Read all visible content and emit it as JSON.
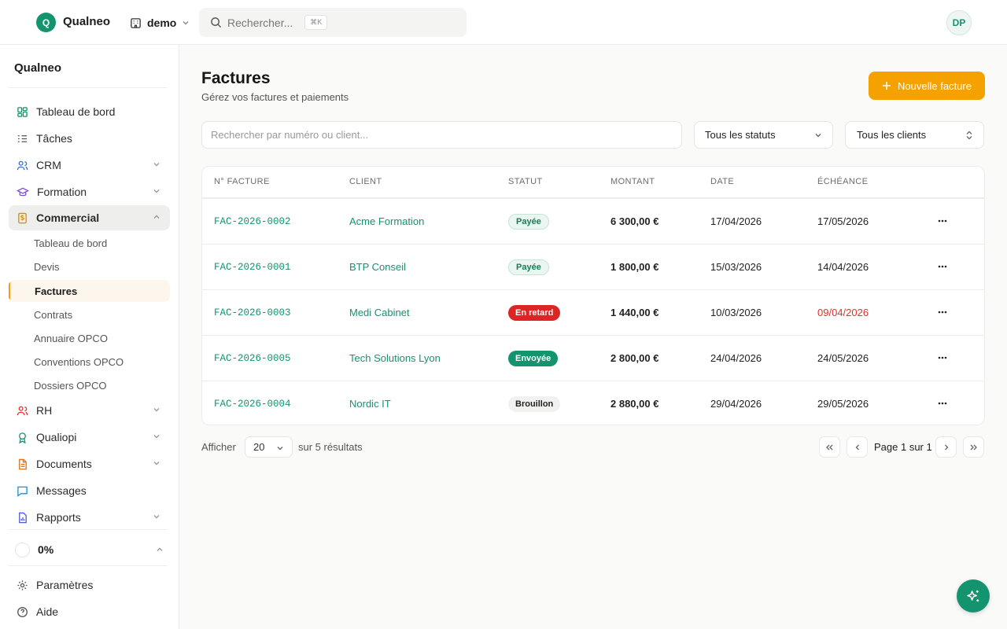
{
  "topbar": {
    "logo_letter": "Q",
    "app_name": "Qualneo",
    "workspace": "demo",
    "search_placeholder": "Rechercher...",
    "search_shortcut": "⌘K",
    "user_initials": "DP"
  },
  "sidebar": {
    "title": "Qualneo",
    "items": [
      {
        "label": "Tableau de bord",
        "icon": "dashboard-icon"
      },
      {
        "label": "Tâches",
        "icon": "tasks-icon"
      },
      {
        "label": "CRM",
        "icon": "users-icon"
      },
      {
        "label": "Formation",
        "icon": "graduation-cap-icon"
      },
      {
        "label": "Commercial",
        "icon": "dollar-file-icon"
      },
      {
        "label": "RH",
        "icon": "people-icon"
      },
      {
        "label": "Qualiopi",
        "icon": "award-icon"
      },
      {
        "label": "Documents",
        "icon": "document-icon"
      },
      {
        "label": "Messages",
        "icon": "message-icon"
      },
      {
        "label": "Rapports",
        "icon": "report-icon"
      }
    ],
    "commercial_sub": [
      "Tableau de bord",
      "Devis",
      "Factures",
      "Contrats",
      "Annuaire OPCO",
      "Conventions OPCO",
      "Dossiers OPCO"
    ],
    "progress_label": "0%",
    "settings_label": "Paramètres",
    "help_label": "Aide"
  },
  "page": {
    "title": "Factures",
    "subtitle": "Gérez vos factures et paiements",
    "new_button": "Nouvelle facture",
    "search_placeholder": "Rechercher par numéro ou client...",
    "status_filter": "Tous les statuts",
    "client_filter": "Tous les clients"
  },
  "table": {
    "headers": [
      "N° FACTURE",
      "CLIENT",
      "STATUT",
      "MONTANT",
      "DATE",
      "ÉCHÉANCE"
    ],
    "rows": [
      {
        "number": "FAC-2026-0002",
        "client": "Acme Formation",
        "status": "Payée",
        "status_type": "paid",
        "amount": "6 300,00 €",
        "date": "17/04/2026",
        "due": "17/05/2026",
        "overdue": false
      },
      {
        "number": "FAC-2026-0001",
        "client": "BTP Conseil",
        "status": "Payée",
        "status_type": "paid",
        "amount": "1 800,00 €",
        "date": "15/03/2026",
        "due": "14/04/2026",
        "overdue": false
      },
      {
        "number": "FAC-2026-0003",
        "client": "Medi Cabinet",
        "status": "En retard",
        "status_type": "late",
        "amount": "1 440,00 €",
        "date": "10/03/2026",
        "due": "09/04/2026",
        "overdue": true
      },
      {
        "number": "FAC-2026-0005",
        "client": "Tech Solutions Lyon",
        "status": "Envoyée",
        "status_type": "sent",
        "amount": "2 800,00 €",
        "date": "24/04/2026",
        "due": "24/05/2026",
        "overdue": false
      },
      {
        "number": "FAC-2026-0004",
        "client": "Nordic IT",
        "status": "Brouillon",
        "status_type": "draft",
        "amount": "2 880,00 €",
        "date": "29/04/2026",
        "due": "29/05/2026",
        "overdue": false
      }
    ]
  },
  "footer": {
    "show_label": "Afficher",
    "page_size": "20",
    "results_label": "sur 5 résultats",
    "page_label": "Page 1 sur 1"
  },
  "colors": {
    "brand": "#14936f",
    "accent": "#f5a200",
    "danger": "#dc2626"
  }
}
